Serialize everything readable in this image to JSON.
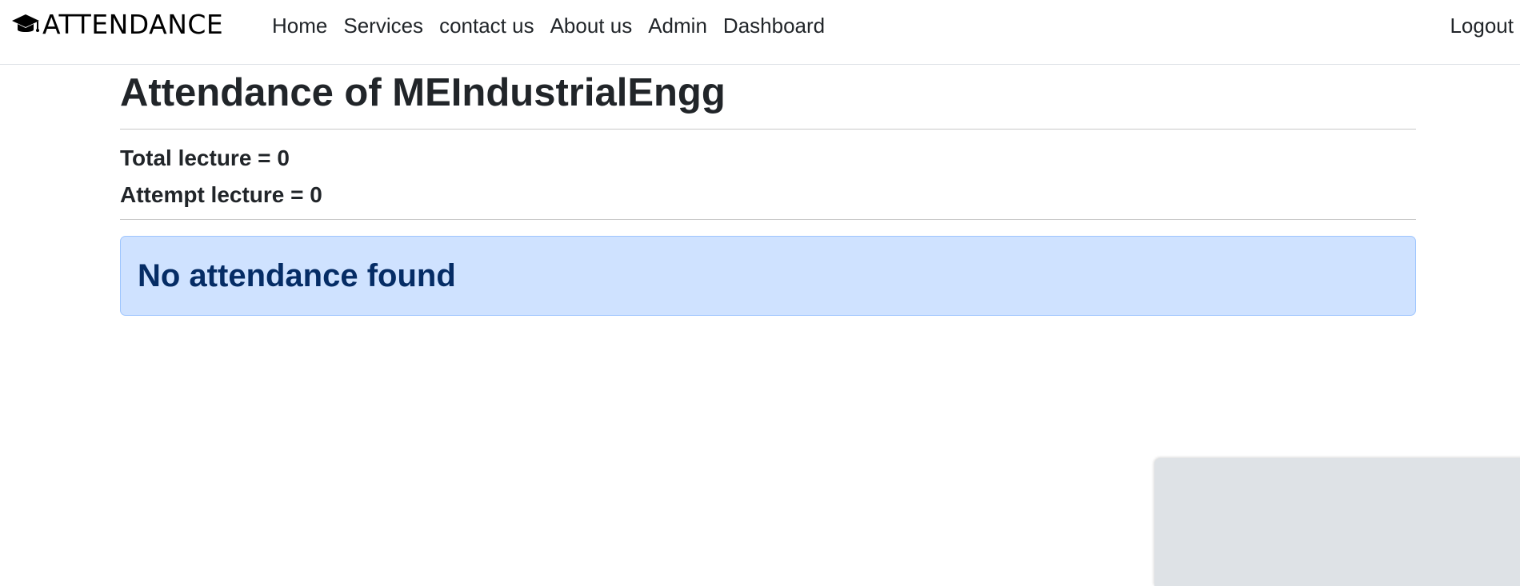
{
  "brand": {
    "text": "ATTENDANCE",
    "icon": "graduation-cap-icon"
  },
  "nav": {
    "items": [
      {
        "label": "Home"
      },
      {
        "label": "Services"
      },
      {
        "label": "contact us"
      },
      {
        "label": "About us"
      },
      {
        "label": "Admin"
      },
      {
        "label": "Dashboard"
      }
    ],
    "logout_label": "Logout"
  },
  "main": {
    "title": "Attendance of MEIndustrialEngg",
    "total_lecture": "Total lecture = 0",
    "attempt_lecture": "Attempt lecture = 0",
    "alert_text": "No attendance found"
  },
  "colors": {
    "alert_bg": "#cfe2ff",
    "alert_border": "#9ec5fe",
    "alert_text": "#052c65",
    "panel_bg": "#dee2e6"
  }
}
